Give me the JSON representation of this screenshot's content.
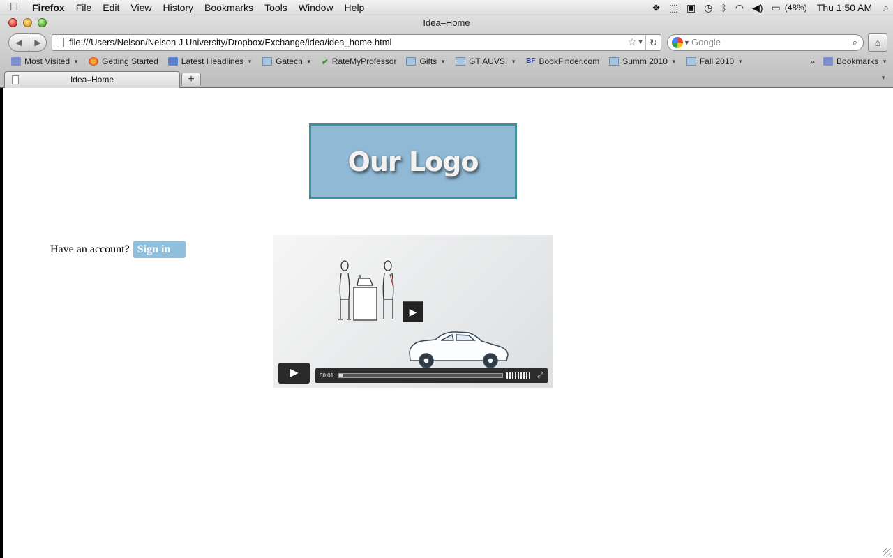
{
  "menubar": {
    "app_name": "Firefox",
    "items": [
      "File",
      "Edit",
      "View",
      "History",
      "Bookmarks",
      "Tools",
      "Window",
      "Help"
    ],
    "battery": "(48%)",
    "clock": "Thu 1:50 AM"
  },
  "window": {
    "title": "Idea–Home"
  },
  "navbar": {
    "url": "file:///Users/Nelson/Nelson J University/Dropbox/Exchange/idea/idea_home.html",
    "search_placeholder": "Google"
  },
  "bookmarks": {
    "items": [
      {
        "label": "Most Visited",
        "icon": "special-folder-icon",
        "has_menu": true
      },
      {
        "label": "Getting Started",
        "icon": "firefox-icon",
        "has_menu": false
      },
      {
        "label": "Latest Headlines",
        "icon": "rss-icon",
        "has_menu": true
      },
      {
        "label": "Gatech",
        "icon": "folder-icon",
        "has_menu": true
      },
      {
        "label": "RateMyProfessor",
        "icon": "check-icon",
        "has_menu": false
      },
      {
        "label": "Gifts",
        "icon": "folder-icon",
        "has_menu": true
      },
      {
        "label": "GT AUVSI",
        "icon": "folder-icon",
        "has_menu": true
      },
      {
        "label": "BookFinder.com",
        "icon": "bookfinder-icon",
        "has_menu": false
      },
      {
        "label": "Summ 2010",
        "icon": "folder-icon",
        "has_menu": true
      },
      {
        "label": "Fall 2010",
        "icon": "folder-icon",
        "has_menu": true
      }
    ],
    "bf_badge": "BF",
    "overflow": "»",
    "bookmarks_menu": "Bookmarks"
  },
  "tabs": {
    "active_label": "Idea–Home",
    "new_tab": "+"
  },
  "page": {
    "logo_text": "Our Logo",
    "account_prompt": "Have an account?",
    "signin_label": "Sign in",
    "video": {
      "time": "00:01",
      "progress": 0.01
    }
  }
}
